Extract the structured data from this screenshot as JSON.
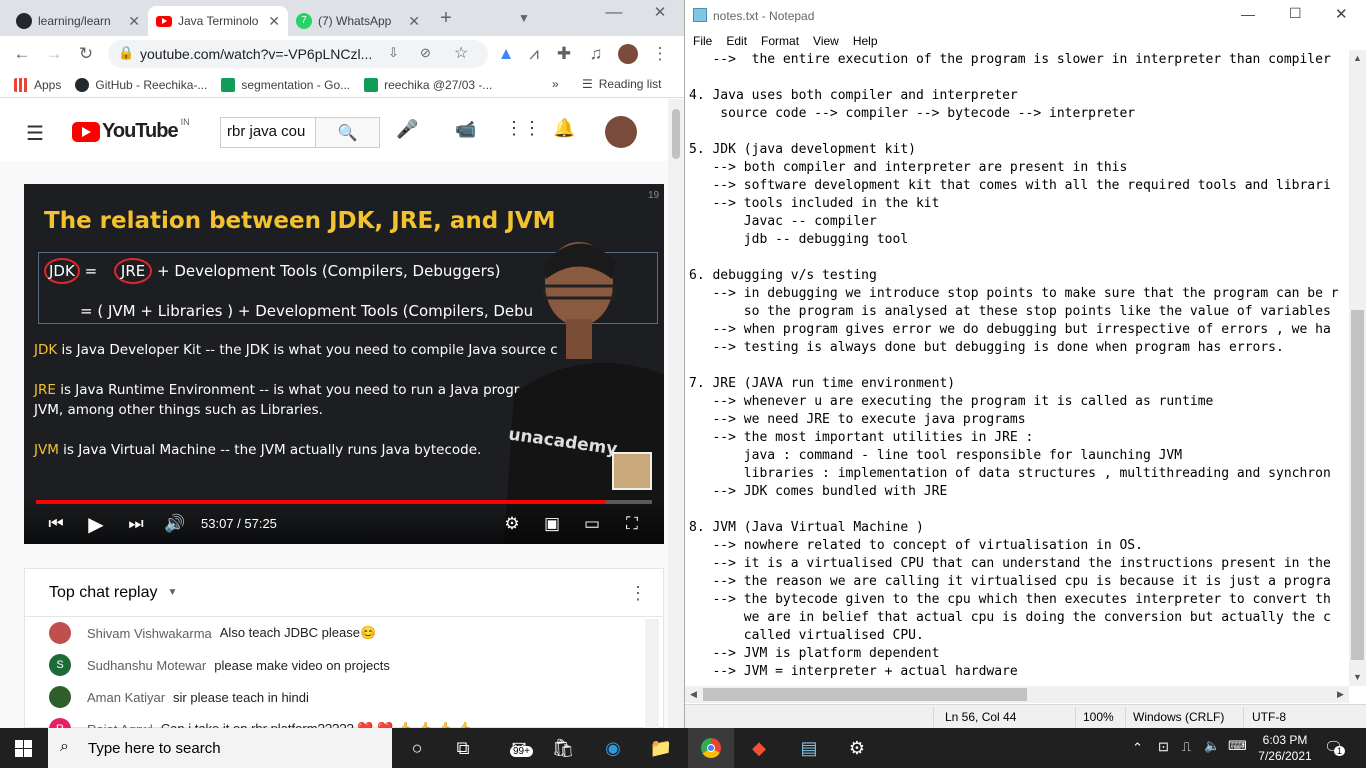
{
  "chrome": {
    "tabs": [
      {
        "title": "learning/learn",
        "icon": "github-icon"
      },
      {
        "title": "Java Terminolo",
        "icon": "youtube-icon"
      },
      {
        "title": "(7) WhatsApp",
        "icon": "whatsapp-icon"
      }
    ],
    "new_tab": "+",
    "window_min": "—",
    "window_max": "☐",
    "window_close": "✕",
    "url": "youtube.com/watch?v=-VP6pLNCzl...",
    "bookmarks": [
      {
        "label": "Apps",
        "color": "#4285f4"
      },
      {
        "label": "GitHub - Reechika-...",
        "color": "#24292e"
      },
      {
        "label": "segmentation - Go...",
        "color": "#0f9d58"
      },
      {
        "label": "reechika @27/03 -...",
        "color": "#0f9d58"
      }
    ],
    "bookmarks_more": "»",
    "reading_list": "Reading list"
  },
  "youtube": {
    "logo_text": "YouTube",
    "country": "IN",
    "search_value": "rbr java cou",
    "video": {
      "slide_title": "The relation between JDK, JRE, and JVM",
      "slide_number": "19",
      "line1_a": "JDK",
      "line1_b": " = ",
      "line1_c": "JRE",
      "line1_d": " +  Development Tools (Compilers, Debuggers)",
      "line2": "= ( JVM + Libraries )  +  Development Tools (Compilers, Debu",
      "jdk_term": "JDK",
      "jdk_desc": " is Java Developer Kit -- the JDK is what you need to compile Java source c",
      "jre_term": "JRE",
      "jre_desc": " is Java Runtime Environment -- is what you need to run a Java progr",
      "jre_desc2": "JVM, among other things such as Libraries.",
      "jvm_term": "JVM",
      "jvm_desc": " is Java Virtual Machine -- the JVM actually runs Java bytecode.",
      "shirt_text": "unacademy",
      "time": "53:07 / 57:25",
      "progress_fraction": 0.925
    },
    "chat": {
      "header": "Top chat replay",
      "messages": [
        {
          "author": "Shivam Vishwakarma",
          "text": "Also teach JDBC please😊",
          "avatar_color": "#c0504d",
          "initial": ""
        },
        {
          "author": "Sudhanshu Motewar",
          "text": "please make video on projects",
          "avatar_color": "#1e6b3a",
          "initial": "S"
        },
        {
          "author": "Aman Katiyar",
          "text": "sir please teach in hindi",
          "avatar_color": "#2e5e2a",
          "initial": ""
        },
        {
          "author": "Rajat Agrwl",
          "text": "Can i take it on rbr platform????? ❤️ ❤️ 👍 👍 👍 👍",
          "avatar_color": "#e91e63",
          "initial": "R"
        }
      ]
    }
  },
  "notepad": {
    "title": "notes.txt - Notepad",
    "menu": [
      "File",
      "Edit",
      "Format",
      "View",
      "Help"
    ],
    "lines": [
      "   -->  the entire execution of the program is slower in interpreter than compiler",
      "",
      "4. Java uses both compiler and interpreter",
      "    source code --> compiler --> bytecode --> interpreter",
      "",
      "5. JDK (java development kit)",
      "   --> both compiler and interpreter are present in this",
      "   --> software development kit that comes with all the required tools and librari",
      "   --> tools included in the kit",
      "       Javac -- compiler",
      "       jdb -- debugging tool",
      "",
      "6. debugging v/s testing",
      "   --> in debugging we introduce stop points to make sure that the program can be r",
      "       so the program is analysed at these stop points like the value of variables",
      "   --> when program gives error we do debugging but irrespective of errors , we ha",
      "   --> testing is always done but debugging is done when program has errors.",
      "",
      "7. JRE (JAVA run time environment)",
      "   --> whenever u are executing the program it is called as runtime",
      "   --> we need JRE to execute java programs",
      "   --> the most important utilities in JRE :",
      "       java : command - line tool responsible for launching JVM",
      "       libraries : implementation of data structures , multithreading and synchron",
      "   --> JDK comes bundled with JRE",
      "",
      "8. JVM (Java Virtual Machine )",
      "   --> nowhere related to concept of virtualisation in OS.",
      "   --> it is a virtualised CPU that can understand the instructions present in the",
      "   --> the reason we are calling it virtualised cpu is because it is just a progra",
      "   --> the bytecode given to the cpu which then executes interpreter to convert th",
      "       we are in belief that actual cpu is doing the conversion but actually the c",
      "       called virtualised CPU.",
      "   --> JVM is platform dependent",
      "   --> JVM = interpreter + actual hardware"
    ],
    "status": {
      "position": "Ln 56, Col 44",
      "zoom": "100%",
      "line_ending": "Windows (CRLF)",
      "encoding": "UTF-8"
    }
  },
  "taskbar": {
    "search_placeholder": "Type here to search",
    "mail_badge": "99+",
    "time": "6:03 PM",
    "date": "7/26/2021",
    "notifications": "1"
  }
}
